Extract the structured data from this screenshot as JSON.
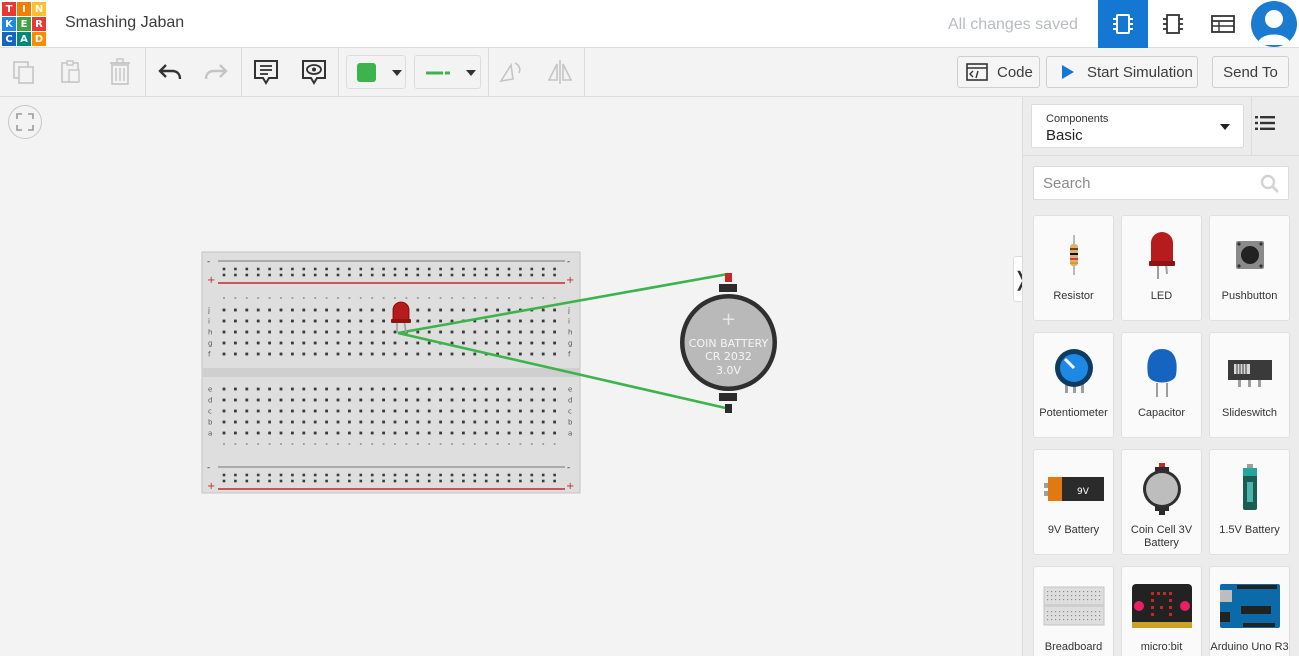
{
  "header": {
    "logo_letters": [
      "T",
      "I",
      "N",
      "K",
      "E",
      "R",
      "C",
      "A",
      "D"
    ],
    "logo_colors": [
      "#e53935",
      "#f57c00",
      "#fbc02d",
      "#1e88e5",
      "#43a047",
      "#e53935",
      "#1565c0",
      "#00897b",
      "#fb8c00"
    ],
    "title": "Smashing Jaban",
    "save_status": "All changes saved",
    "views": [
      "circuit-view-icon",
      "schematic-view-icon",
      "component-list-icon"
    ],
    "accent_color": "#1477d1"
  },
  "toolbar": {
    "tools": [
      "copy-icon",
      "paste-icon",
      "delete-icon",
      "undo-icon",
      "redo-icon",
      "notes-icon",
      "toggle-notes-icon"
    ],
    "wire_color": "#3cb44b",
    "code_label": "Code",
    "simulate_label": "Start Simulation",
    "send_to_label": "Send To"
  },
  "canvas": {
    "battery": {
      "line1": "COIN BATTERY",
      "line2": "CR 2032",
      "line3": "3.0V",
      "plus": "+"
    },
    "breadboard": {
      "row_letters_top": [
        "j",
        "i",
        "h",
        "g",
        "f"
      ],
      "row_letters_bottom": [
        "e",
        "d",
        "c",
        "b",
        "a"
      ],
      "plus": "+",
      "minus": "-"
    },
    "wire_color": "#3cb44b",
    "led_color": "#b71c1c"
  },
  "panel": {
    "category_caption": "Components",
    "category_value": "Basic",
    "search_placeholder": "Search",
    "components": [
      {
        "label": "Resistor",
        "icon": "resistor-icon"
      },
      {
        "label": "LED",
        "icon": "led-icon"
      },
      {
        "label": "Pushbutton",
        "icon": "pushbutton-icon"
      },
      {
        "label": "Potentiometer",
        "icon": "potentiometer-icon"
      },
      {
        "label": "Capacitor",
        "icon": "capacitor-icon"
      },
      {
        "label": "Slideswitch",
        "icon": "slideswitch-icon"
      },
      {
        "label": "9V Battery",
        "icon": "9v-battery-icon"
      },
      {
        "label": "Coin Cell 3V Battery",
        "icon": "coin-cell-icon"
      },
      {
        "label": "1.5V Battery",
        "icon": "aa-battery-icon"
      },
      {
        "label": "Breadboard",
        "icon": "breadboard-icon"
      },
      {
        "label": "micro:bit",
        "icon": "microbit-icon"
      },
      {
        "label": "Arduino Uno R3",
        "icon": "arduino-icon"
      }
    ],
    "nine_volt_text": "9V",
    "collapse_glyph": "❭"
  }
}
